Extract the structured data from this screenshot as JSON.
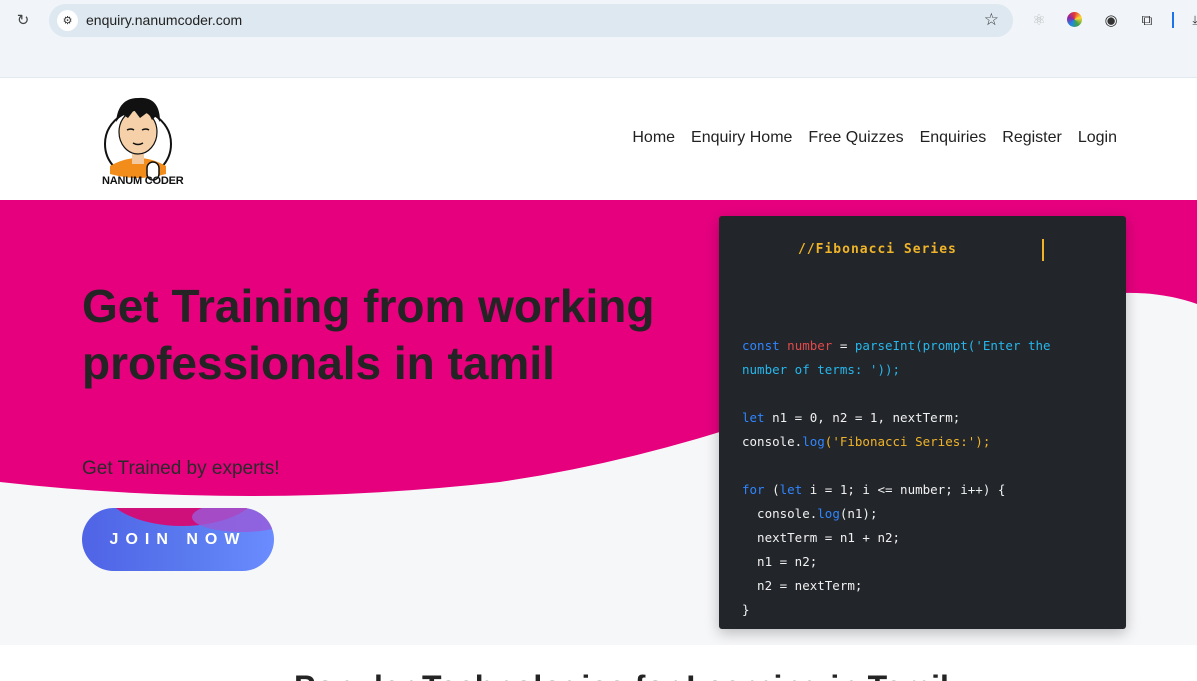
{
  "browser": {
    "url": "enquiry.nanumcoder.com"
  },
  "site": {
    "logo_text": "NANUM CODER",
    "nav": [
      "Home",
      "Enquiry Home",
      "Free Quizzes",
      "Enquiries",
      "Register",
      "Login"
    ]
  },
  "hero": {
    "headline": "Get Training from working professionals in tamil",
    "subheading": "Get Trained by experts!",
    "cta_label": "JOIN NOW",
    "colors": {
      "magenta": "#e6007e",
      "light": "#f6f7f9",
      "button_blue": "#5b7cf0"
    }
  },
  "code_card": {
    "title": "//Fibonacci Series",
    "lines": [
      [],
      [
        [
          "kw",
          "const"
        ],
        [
          "t",
          " "
        ],
        [
          "var",
          "number"
        ],
        [
          "t",
          " = "
        ],
        [
          "fn",
          "parseInt(prompt('Enter the"
        ]
      ],
      [
        [
          "fn",
          "number of terms: '));"
        ]
      ],
      [],
      [
        [
          "kw",
          "let"
        ],
        [
          "t",
          " n1 = 0, n2 = 1, nextTerm;"
        ]
      ],
      [
        [
          "t",
          "console."
        ],
        [
          "kw",
          "log"
        ],
        [
          "str",
          "('Fibonacci Series:');"
        ]
      ],
      [],
      [
        [
          "kw",
          "for"
        ],
        [
          "t",
          " ("
        ],
        [
          "kw",
          "let"
        ],
        [
          "t",
          " i = 1; i <= number; i++) {"
        ]
      ],
      [
        [
          "t",
          "  console."
        ],
        [
          "kw",
          "log"
        ],
        [
          "t",
          "(n1);"
        ]
      ],
      [
        [
          "t",
          "  nextTerm = n1 + n2;"
        ]
      ],
      [
        [
          "t",
          "  n1 = n2;"
        ]
      ],
      [
        [
          "t",
          "  n2 = nextTerm;"
        ]
      ],
      [
        [
          "t",
          "}"
        ]
      ]
    ],
    "colors": {
      "background": "#22252a",
      "keyword": "#2f86ff",
      "variable": "#e24a4a",
      "function": "#26b7ec",
      "string": "#f0b429"
    }
  },
  "section": {
    "title_partial": "Popular Technologies for Learning in Tamil"
  }
}
